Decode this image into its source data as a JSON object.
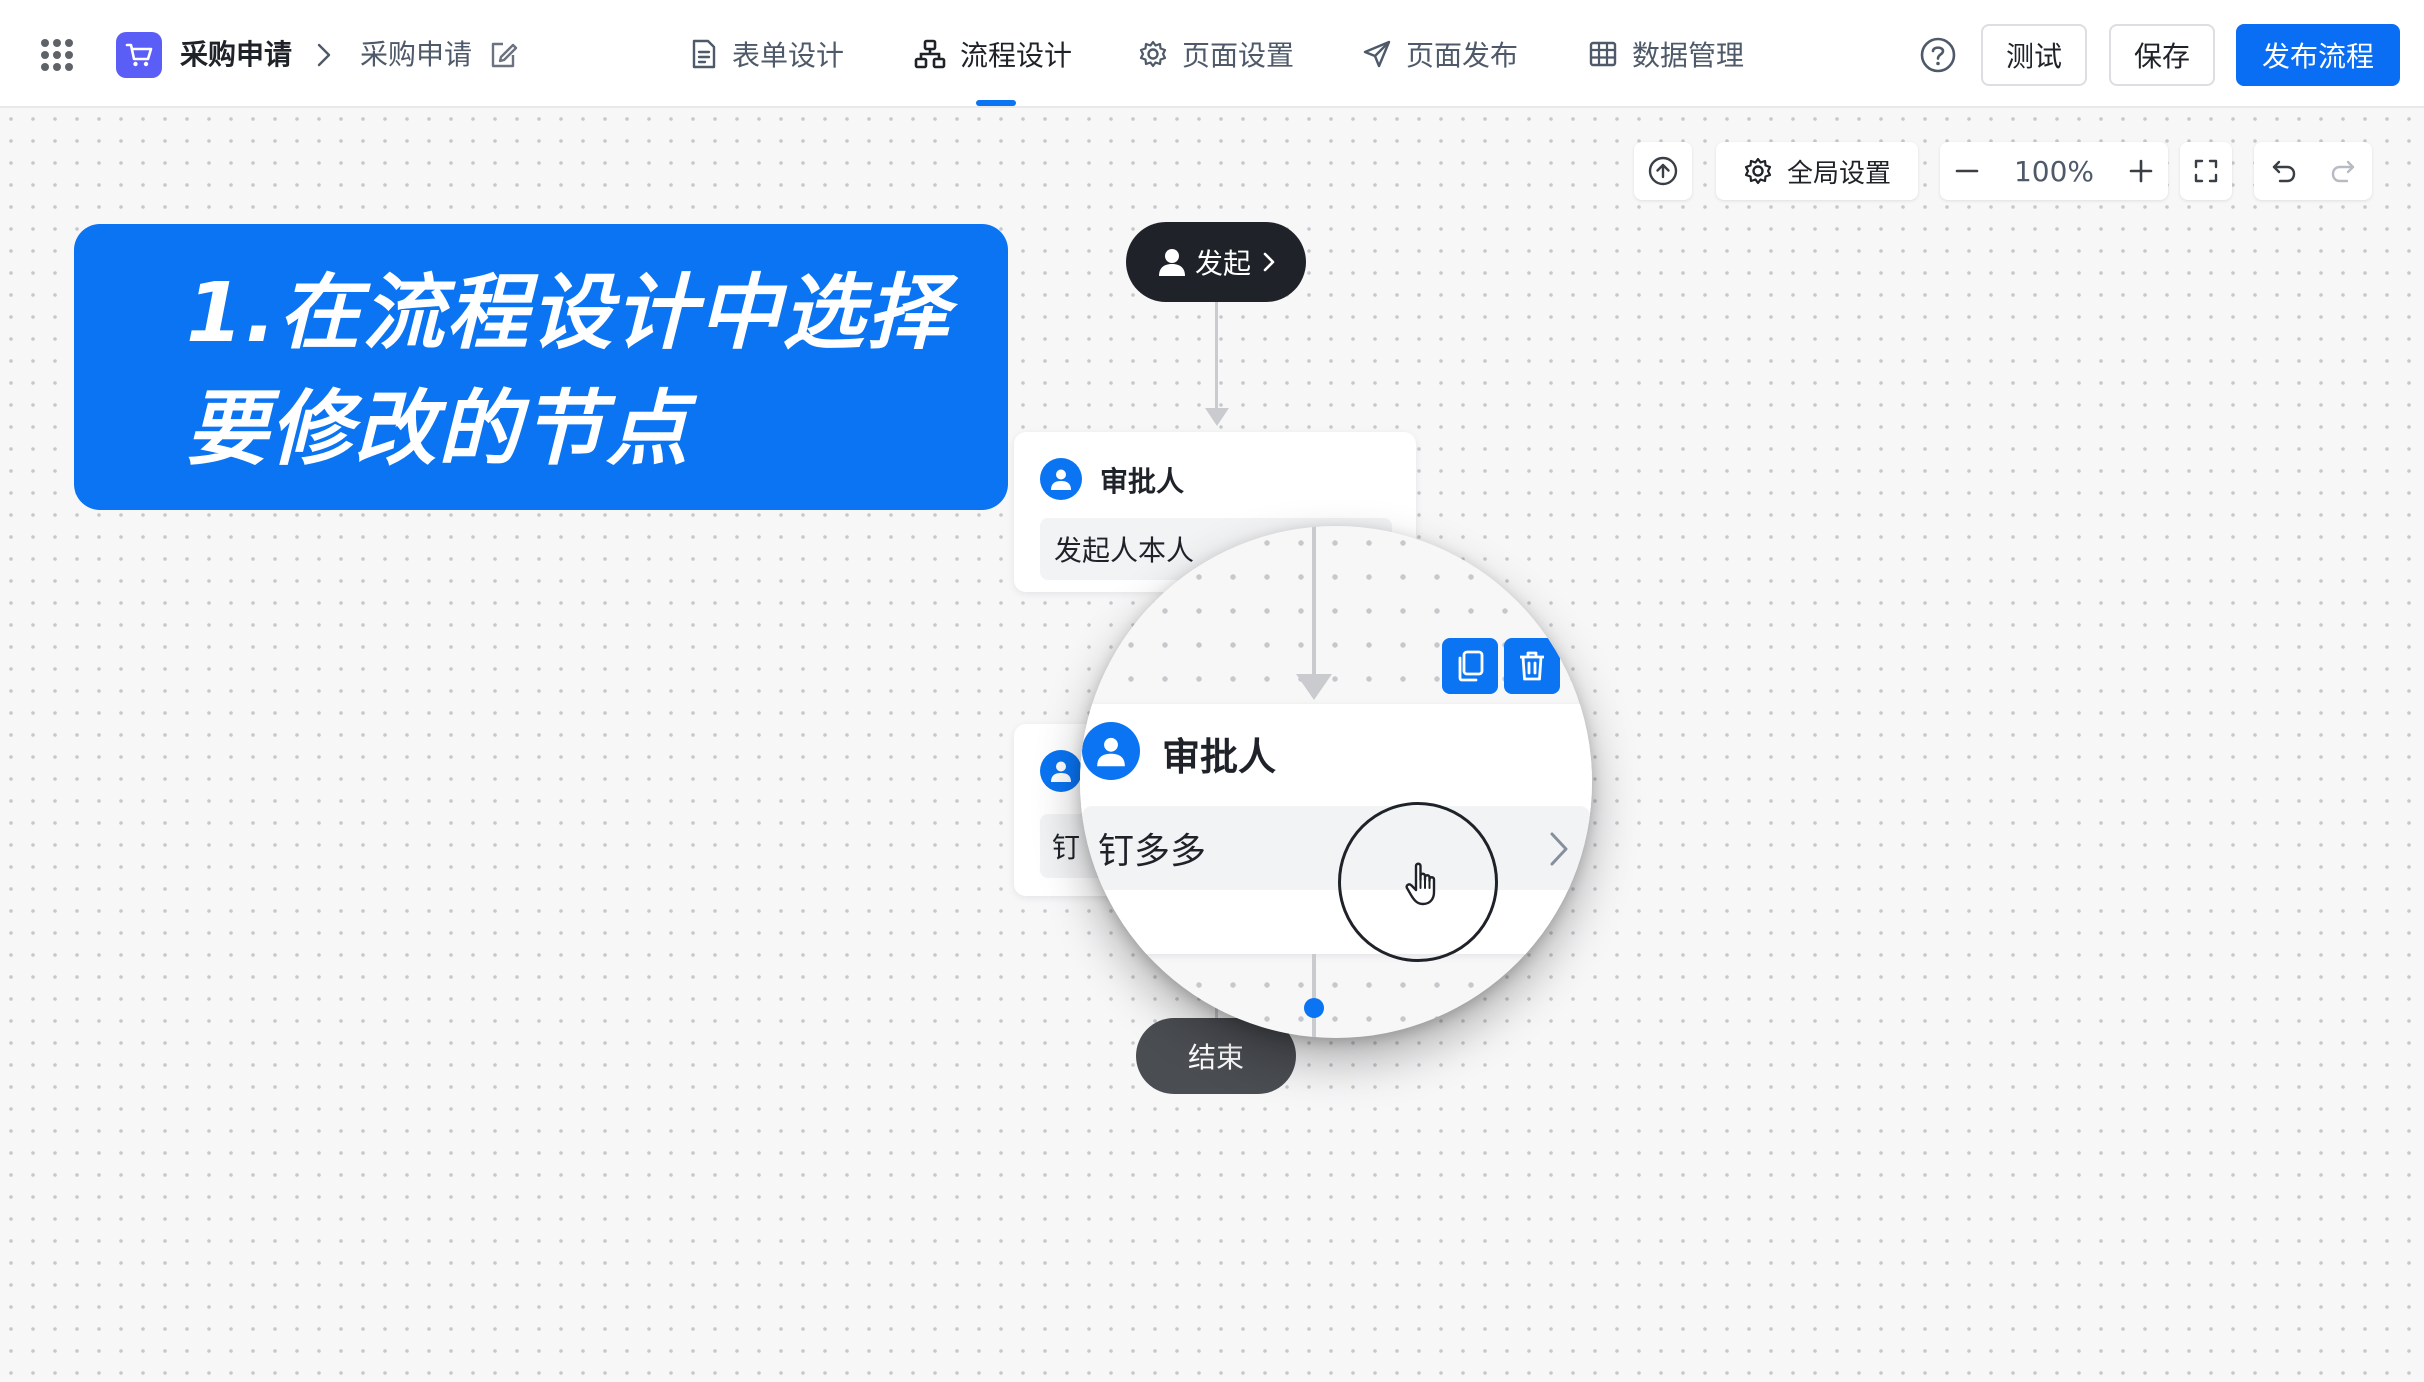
{
  "header": {
    "app_name": "采购申请",
    "breadcrumb_separator": "›",
    "form_name": "采购申请",
    "tabs": [
      {
        "label": "表单设计",
        "icon": "document-icon",
        "active": false
      },
      {
        "label": "流程设计",
        "icon": "flow-icon",
        "active": true
      },
      {
        "label": "页面设置",
        "icon": "gear-icon",
        "active": false
      },
      {
        "label": "页面发布",
        "icon": "send-icon",
        "active": false
      },
      {
        "label": "数据管理",
        "icon": "table-icon",
        "active": false
      }
    ],
    "test_label": "测试",
    "save_label": "保存",
    "publish_label": "发布流程"
  },
  "toolbar": {
    "global_settings_label": "全局设置",
    "zoom_level": "100%"
  },
  "callout": {
    "line1": "1.在流程设计中选择",
    "line2": "要修改的节点"
  },
  "flow": {
    "start_label": "发起",
    "approver1_title": "审批人",
    "approver1_value": "发起人本人",
    "approver2_title": "审批人",
    "approver2_value_partial": "钉",
    "end_label": "结束"
  },
  "magnifier": {
    "node_title": "审批人",
    "node_value": "钉多多"
  },
  "colors": {
    "accent": "#0a74f2",
    "primary_button": "#0a6ef5",
    "start_node": "#1f2329",
    "end_node": "#4a4d52",
    "app_icon": "#5b5ef6"
  }
}
